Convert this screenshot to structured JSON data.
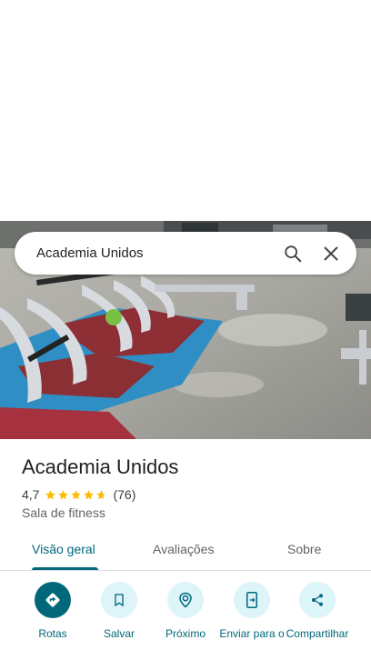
{
  "search": {
    "query": "Academia Unidos",
    "search_icon": "search-icon",
    "close_icon": "close-icon"
  },
  "place": {
    "name": "Academia Unidos",
    "rating": "4,7",
    "stars": 4.7,
    "review_count": "(76)",
    "category": "Sala de fitness"
  },
  "tabs": [
    {
      "label": "Visão geral",
      "active": true
    },
    {
      "label": "Avaliações",
      "active": false
    },
    {
      "label": "Sobre",
      "active": false
    }
  ],
  "actions": [
    {
      "label": "Rotas",
      "icon": "directions-icon"
    },
    {
      "label": "Salvar",
      "icon": "bookmark-icon"
    },
    {
      "label": "Próximo",
      "icon": "nearby-icon"
    },
    {
      "label": "Enviar para o",
      "icon": "send-to-phone-icon"
    },
    {
      "label": "Compartilhar",
      "icon": "share-icon"
    }
  ],
  "colors": {
    "accent": "#00687a",
    "accent_light": "#ddf4f8",
    "star": "#fbbc04"
  }
}
